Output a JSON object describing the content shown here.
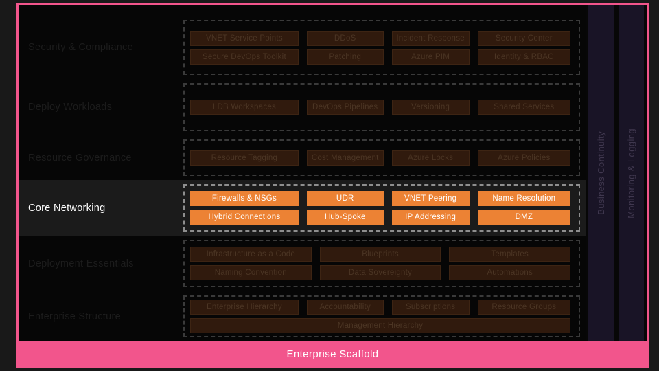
{
  "diagram": {
    "title": "Enterprise Scaffold",
    "accent_pink": "#f2558c",
    "accent_orange": "#ec8234",
    "dim_tile": "#301a0d",
    "band_bg": "#191426"
  },
  "rows": [
    {
      "label": "Security & Compliance",
      "active": false,
      "lines": [
        [
          "VNET Service Points",
          "DDoS",
          "Incident Response",
          "Security Center"
        ],
        [
          "Secure DevOps Toolkit",
          "Patching",
          "Azure PIM",
          "Identity & RBAC"
        ]
      ]
    },
    {
      "label": "Deploy Workloads",
      "active": false,
      "lines": [
        [
          "LDB Workspaces",
          "DevOps Pipelines",
          "Versioning",
          "Shared Services"
        ]
      ]
    },
    {
      "label": "Resource Governance",
      "active": false,
      "lines": [
        [
          "Resource Tagging",
          "Cost Management",
          "Azure Locks",
          "Azure Policies"
        ]
      ]
    },
    {
      "label": "Core Networking",
      "active": true,
      "lines": [
        [
          "Firewalls & NSGs",
          "UDR",
          "VNET Peering",
          "Name Resolution"
        ],
        [
          "Hybrid Connections",
          "Hub-Spoke",
          "IP Addressing",
          "DMZ"
        ]
      ]
    },
    {
      "label": "Deployment Essentials",
      "active": false,
      "lines": [
        [
          "Infrastructure as a Code",
          "Blueprints",
          "Templates"
        ],
        [
          "Naming Convention",
          "Data Sovereignty",
          "Automations"
        ]
      ]
    },
    {
      "label": "Enterprise Structure",
      "active": false,
      "lines": [
        [
          "Enterprise Hierarchy",
          "Accountability",
          "Subscriptions",
          "Resource Groups"
        ],
        [
          "Management Hierarchy"
        ]
      ]
    }
  ],
  "bands": [
    {
      "label": "Business Continuity"
    },
    {
      "label": "Monitoring & Logging"
    }
  ],
  "footer": {
    "label": "Enterprise Scaffold"
  }
}
